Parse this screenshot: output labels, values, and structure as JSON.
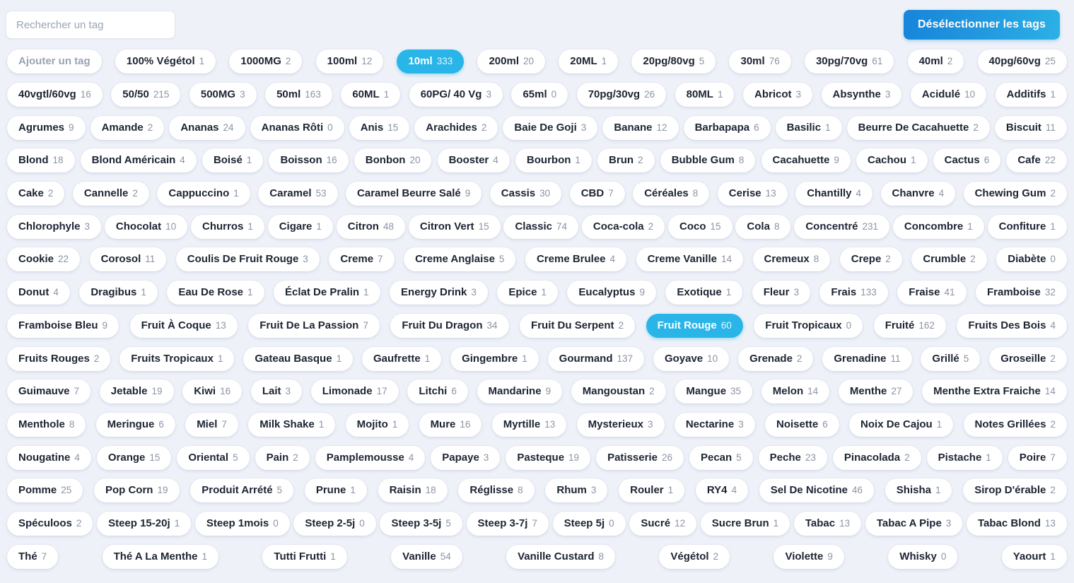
{
  "search": {
    "placeholder": "Rechercher un tag",
    "value": ""
  },
  "toolbar": {
    "deselect_label": "Désélectionner les tags"
  },
  "colors": {
    "page_background": "#eef1f8",
    "tag_background": "#ffffff",
    "tag_selected": "#29b5e8",
    "accent_button_from": "#1785db",
    "accent_button_to": "#2bb1e6",
    "label_text": "#1d2433",
    "count_text": "#8b93a3"
  },
  "add_tag": {
    "label": "Ajouter un tag"
  },
  "rows": [
    [
      {
        "label": "Ajouter un tag",
        "count": "",
        "selected": false,
        "add": true
      },
      {
        "label": "100% Végétol",
        "count": "1",
        "selected": false
      },
      {
        "label": "1000MG",
        "count": "2",
        "selected": false
      },
      {
        "label": "100ml",
        "count": "12",
        "selected": false
      },
      {
        "label": "10ml",
        "count": "333",
        "selected": true
      },
      {
        "label": "200ml",
        "count": "20",
        "selected": false
      },
      {
        "label": "20ML",
        "count": "1",
        "selected": false
      },
      {
        "label": "20pg/80vg",
        "count": "5",
        "selected": false
      },
      {
        "label": "30ml",
        "count": "76",
        "selected": false
      },
      {
        "label": "30pg/70vg",
        "count": "61",
        "selected": false
      },
      {
        "label": "40ml",
        "count": "2",
        "selected": false
      },
      {
        "label": "40pg/60vg",
        "count": "25",
        "selected": false
      }
    ],
    [
      {
        "label": "40vgtl/60vg",
        "count": "16",
        "selected": false
      },
      {
        "label": "50/50",
        "count": "215",
        "selected": false
      },
      {
        "label": "500MG",
        "count": "3",
        "selected": false
      },
      {
        "label": "50ml",
        "count": "163",
        "selected": false
      },
      {
        "label": "60ML",
        "count": "1",
        "selected": false
      },
      {
        "label": "60PG/ 40 Vg",
        "count": "3",
        "selected": false
      },
      {
        "label": "65ml",
        "count": "0",
        "selected": false
      },
      {
        "label": "70pg/30vg",
        "count": "26",
        "selected": false
      },
      {
        "label": "80ML",
        "count": "1",
        "selected": false
      },
      {
        "label": "Abricot",
        "count": "3",
        "selected": false
      },
      {
        "label": "Absynthe",
        "count": "3",
        "selected": false
      },
      {
        "label": "Acidulé",
        "count": "10",
        "selected": false
      },
      {
        "label": "Additifs",
        "count": "1",
        "selected": false
      }
    ],
    [
      {
        "label": "Agrumes",
        "count": "9",
        "selected": false
      },
      {
        "label": "Amande",
        "count": "2",
        "selected": false
      },
      {
        "label": "Ananas",
        "count": "24",
        "selected": false
      },
      {
        "label": "Ananas Rôti",
        "count": "0",
        "selected": false
      },
      {
        "label": "Anis",
        "count": "15",
        "selected": false
      },
      {
        "label": "Arachides",
        "count": "2",
        "selected": false
      },
      {
        "label": "Baie De Goji",
        "count": "3",
        "selected": false
      },
      {
        "label": "Banane",
        "count": "12",
        "selected": false
      },
      {
        "label": "Barbapapa",
        "count": "6",
        "selected": false
      },
      {
        "label": "Basilic",
        "count": "1",
        "selected": false
      },
      {
        "label": "Beurre De Cacahuette",
        "count": "2",
        "selected": false
      },
      {
        "label": "Biscuit",
        "count": "11",
        "selected": false
      }
    ],
    [
      {
        "label": "Blond",
        "count": "18",
        "selected": false
      },
      {
        "label": "Blond Américain",
        "count": "4",
        "selected": false
      },
      {
        "label": "Boisé",
        "count": "1",
        "selected": false
      },
      {
        "label": "Boisson",
        "count": "16",
        "selected": false
      },
      {
        "label": "Bonbon",
        "count": "20",
        "selected": false
      },
      {
        "label": "Booster",
        "count": "4",
        "selected": false
      },
      {
        "label": "Bourbon",
        "count": "1",
        "selected": false
      },
      {
        "label": "Brun",
        "count": "2",
        "selected": false
      },
      {
        "label": "Bubble Gum",
        "count": "8",
        "selected": false
      },
      {
        "label": "Cacahuette",
        "count": "9",
        "selected": false
      },
      {
        "label": "Cachou",
        "count": "1",
        "selected": false
      },
      {
        "label": "Cactus",
        "count": "6",
        "selected": false
      },
      {
        "label": "Cafe",
        "count": "22",
        "selected": false
      }
    ],
    [
      {
        "label": "Cake",
        "count": "2",
        "selected": false
      },
      {
        "label": "Cannelle",
        "count": "2",
        "selected": false
      },
      {
        "label": "Cappuccino",
        "count": "1",
        "selected": false
      },
      {
        "label": "Caramel",
        "count": "53",
        "selected": false
      },
      {
        "label": "Caramel Beurre Salé",
        "count": "9",
        "selected": false
      },
      {
        "label": "Cassis",
        "count": "30",
        "selected": false
      },
      {
        "label": "CBD",
        "count": "7",
        "selected": false
      },
      {
        "label": "Céréales",
        "count": "8",
        "selected": false
      },
      {
        "label": "Cerise",
        "count": "13",
        "selected": false
      },
      {
        "label": "Chantilly",
        "count": "4",
        "selected": false
      },
      {
        "label": "Chanvre",
        "count": "4",
        "selected": false
      },
      {
        "label": "Chewing Gum",
        "count": "2",
        "selected": false
      }
    ],
    [
      {
        "label": "Chlorophyle",
        "count": "3",
        "selected": false
      },
      {
        "label": "Chocolat",
        "count": "10",
        "selected": false
      },
      {
        "label": "Churros",
        "count": "1",
        "selected": false
      },
      {
        "label": "Cigare",
        "count": "1",
        "selected": false
      },
      {
        "label": "Citron",
        "count": "48",
        "selected": false
      },
      {
        "label": "Citron Vert",
        "count": "15",
        "selected": false
      },
      {
        "label": "Classic",
        "count": "74",
        "selected": false
      },
      {
        "label": "Coca-cola",
        "count": "2",
        "selected": false
      },
      {
        "label": "Coco",
        "count": "15",
        "selected": false
      },
      {
        "label": "Cola",
        "count": "8",
        "selected": false
      },
      {
        "label": "Concentré",
        "count": "231",
        "selected": false
      },
      {
        "label": "Concombre",
        "count": "1",
        "selected": false
      },
      {
        "label": "Confiture",
        "count": "1",
        "selected": false
      }
    ],
    [
      {
        "label": "Cookie",
        "count": "22",
        "selected": false
      },
      {
        "label": "Corosol",
        "count": "11",
        "selected": false
      },
      {
        "label": "Coulis De Fruit Rouge",
        "count": "3",
        "selected": false
      },
      {
        "label": "Creme",
        "count": "7",
        "selected": false
      },
      {
        "label": "Creme Anglaise",
        "count": "5",
        "selected": false
      },
      {
        "label": "Creme Brulee",
        "count": "4",
        "selected": false
      },
      {
        "label": "Creme Vanille",
        "count": "14",
        "selected": false
      },
      {
        "label": "Cremeux",
        "count": "8",
        "selected": false
      },
      {
        "label": "Crepe",
        "count": "2",
        "selected": false
      },
      {
        "label": "Crumble",
        "count": "2",
        "selected": false
      },
      {
        "label": "Diabète",
        "count": "0",
        "selected": false
      }
    ],
    [
      {
        "label": "Donut",
        "count": "4",
        "selected": false
      },
      {
        "label": "Dragibus",
        "count": "1",
        "selected": false
      },
      {
        "label": "Eau De Rose",
        "count": "1",
        "selected": false
      },
      {
        "label": "Éclat De Pralin",
        "count": "1",
        "selected": false
      },
      {
        "label": "Energy Drink",
        "count": "3",
        "selected": false
      },
      {
        "label": "Epice",
        "count": "1",
        "selected": false
      },
      {
        "label": "Eucalyptus",
        "count": "9",
        "selected": false
      },
      {
        "label": "Exotique",
        "count": "1",
        "selected": false
      },
      {
        "label": "Fleur",
        "count": "3",
        "selected": false
      },
      {
        "label": "Frais",
        "count": "133",
        "selected": false
      },
      {
        "label": "Fraise",
        "count": "41",
        "selected": false
      },
      {
        "label": "Framboise",
        "count": "32",
        "selected": false
      }
    ],
    [
      {
        "label": "Framboise Bleu",
        "count": "9",
        "selected": false
      },
      {
        "label": "Fruit À Coque",
        "count": "13",
        "selected": false
      },
      {
        "label": "Fruit De La Passion",
        "count": "7",
        "selected": false
      },
      {
        "label": "Fruit Du Dragon",
        "count": "34",
        "selected": false
      },
      {
        "label": "Fruit Du Serpent",
        "count": "2",
        "selected": false
      },
      {
        "label": "Fruit Rouge",
        "count": "60",
        "selected": true
      },
      {
        "label": "Fruit Tropicaux",
        "count": "0",
        "selected": false
      },
      {
        "label": "Fruité",
        "count": "162",
        "selected": false
      },
      {
        "label": "Fruits Des Bois",
        "count": "4",
        "selected": false
      }
    ],
    [
      {
        "label": "Fruits Rouges",
        "count": "2",
        "selected": false
      },
      {
        "label": "Fruits Tropicaux",
        "count": "1",
        "selected": false
      },
      {
        "label": "Gateau Basque",
        "count": "1",
        "selected": false
      },
      {
        "label": "Gaufrette",
        "count": "1",
        "selected": false
      },
      {
        "label": "Gingembre",
        "count": "1",
        "selected": false
      },
      {
        "label": "Gourmand",
        "count": "137",
        "selected": false
      },
      {
        "label": "Goyave",
        "count": "10",
        "selected": false
      },
      {
        "label": "Grenade",
        "count": "2",
        "selected": false
      },
      {
        "label": "Grenadine",
        "count": "11",
        "selected": false
      },
      {
        "label": "Grillé",
        "count": "5",
        "selected": false
      },
      {
        "label": "Groseille",
        "count": "2",
        "selected": false
      }
    ],
    [
      {
        "label": "Guimauve",
        "count": "7",
        "selected": false
      },
      {
        "label": "Jetable",
        "count": "19",
        "selected": false
      },
      {
        "label": "Kiwi",
        "count": "16",
        "selected": false
      },
      {
        "label": "Lait",
        "count": "3",
        "selected": false
      },
      {
        "label": "Limonade",
        "count": "17",
        "selected": false
      },
      {
        "label": "Litchi",
        "count": "6",
        "selected": false
      },
      {
        "label": "Mandarine",
        "count": "9",
        "selected": false
      },
      {
        "label": "Mangoustan",
        "count": "2",
        "selected": false
      },
      {
        "label": "Mangue",
        "count": "35",
        "selected": false
      },
      {
        "label": "Melon",
        "count": "14",
        "selected": false
      },
      {
        "label": "Menthe",
        "count": "27",
        "selected": false
      },
      {
        "label": "Menthe Extra Fraiche",
        "count": "14",
        "selected": false
      }
    ],
    [
      {
        "label": "Menthole",
        "count": "8",
        "selected": false
      },
      {
        "label": "Meringue",
        "count": "6",
        "selected": false
      },
      {
        "label": "Miel",
        "count": "7",
        "selected": false
      },
      {
        "label": "Milk Shake",
        "count": "1",
        "selected": false
      },
      {
        "label": "Mojito",
        "count": "1",
        "selected": false
      },
      {
        "label": "Mure",
        "count": "16",
        "selected": false
      },
      {
        "label": "Myrtille",
        "count": "13",
        "selected": false
      },
      {
        "label": "Mysterieux",
        "count": "3",
        "selected": false
      },
      {
        "label": "Nectarine",
        "count": "3",
        "selected": false
      },
      {
        "label": "Noisette",
        "count": "6",
        "selected": false
      },
      {
        "label": "Noix De Cajou",
        "count": "1",
        "selected": false
      },
      {
        "label": "Notes Grillées",
        "count": "2",
        "selected": false
      }
    ],
    [
      {
        "label": "Nougatine",
        "count": "4",
        "selected": false
      },
      {
        "label": "Orange",
        "count": "15",
        "selected": false
      },
      {
        "label": "Oriental",
        "count": "5",
        "selected": false
      },
      {
        "label": "Pain",
        "count": "2",
        "selected": false
      },
      {
        "label": "Pamplemousse",
        "count": "4",
        "selected": false
      },
      {
        "label": "Papaye",
        "count": "3",
        "selected": false
      },
      {
        "label": "Pasteque",
        "count": "19",
        "selected": false
      },
      {
        "label": "Patisserie",
        "count": "26",
        "selected": false
      },
      {
        "label": "Pecan",
        "count": "5",
        "selected": false
      },
      {
        "label": "Peche",
        "count": "23",
        "selected": false
      },
      {
        "label": "Pinacolada",
        "count": "2",
        "selected": false
      },
      {
        "label": "Pistache",
        "count": "1",
        "selected": false
      },
      {
        "label": "Poire",
        "count": "7",
        "selected": false
      }
    ],
    [
      {
        "label": "Pomme",
        "count": "25",
        "selected": false
      },
      {
        "label": "Pop Corn",
        "count": "19",
        "selected": false
      },
      {
        "label": "Produit Arrété",
        "count": "5",
        "selected": false
      },
      {
        "label": "Prune",
        "count": "1",
        "selected": false
      },
      {
        "label": "Raisin",
        "count": "18",
        "selected": false
      },
      {
        "label": "Réglisse",
        "count": "8",
        "selected": false
      },
      {
        "label": "Rhum",
        "count": "3",
        "selected": false
      },
      {
        "label": "Rouler",
        "count": "1",
        "selected": false
      },
      {
        "label": "RY4",
        "count": "4",
        "selected": false
      },
      {
        "label": "Sel De Nicotine",
        "count": "46",
        "selected": false
      },
      {
        "label": "Shisha",
        "count": "1",
        "selected": false
      },
      {
        "label": "Sirop D'érable",
        "count": "2",
        "selected": false
      }
    ],
    [
      {
        "label": "Spéculoos",
        "count": "2",
        "selected": false
      },
      {
        "label": "Steep 15-20j",
        "count": "1",
        "selected": false
      },
      {
        "label": "Steep 1mois",
        "count": "0",
        "selected": false
      },
      {
        "label": "Steep 2-5j",
        "count": "0",
        "selected": false
      },
      {
        "label": "Steep 3-5j",
        "count": "5",
        "selected": false
      },
      {
        "label": "Steep 3-7j",
        "count": "7",
        "selected": false
      },
      {
        "label": "Steep 5j",
        "count": "0",
        "selected": false
      },
      {
        "label": "Sucré",
        "count": "12",
        "selected": false
      },
      {
        "label": "Sucre Brun",
        "count": "1",
        "selected": false
      },
      {
        "label": "Tabac",
        "count": "13",
        "selected": false
      },
      {
        "label": "Tabac A Pipe",
        "count": "3",
        "selected": false
      },
      {
        "label": "Tabac Blond",
        "count": "13",
        "selected": false
      }
    ],
    [
      {
        "label": "Thé",
        "count": "7",
        "selected": false
      },
      {
        "label": "Thé A La Menthe",
        "count": "1",
        "selected": false
      },
      {
        "label": "Tutti Frutti",
        "count": "1",
        "selected": false
      },
      {
        "label": "Vanille",
        "count": "54",
        "selected": false
      },
      {
        "label": "Vanille Custard",
        "count": "8",
        "selected": false
      },
      {
        "label": "Végétol",
        "count": "2",
        "selected": false
      },
      {
        "label": "Violette",
        "count": "9",
        "selected": false
      },
      {
        "label": "Whisky",
        "count": "0",
        "selected": false
      },
      {
        "label": "Yaourt",
        "count": "1",
        "selected": false
      }
    ]
  ]
}
